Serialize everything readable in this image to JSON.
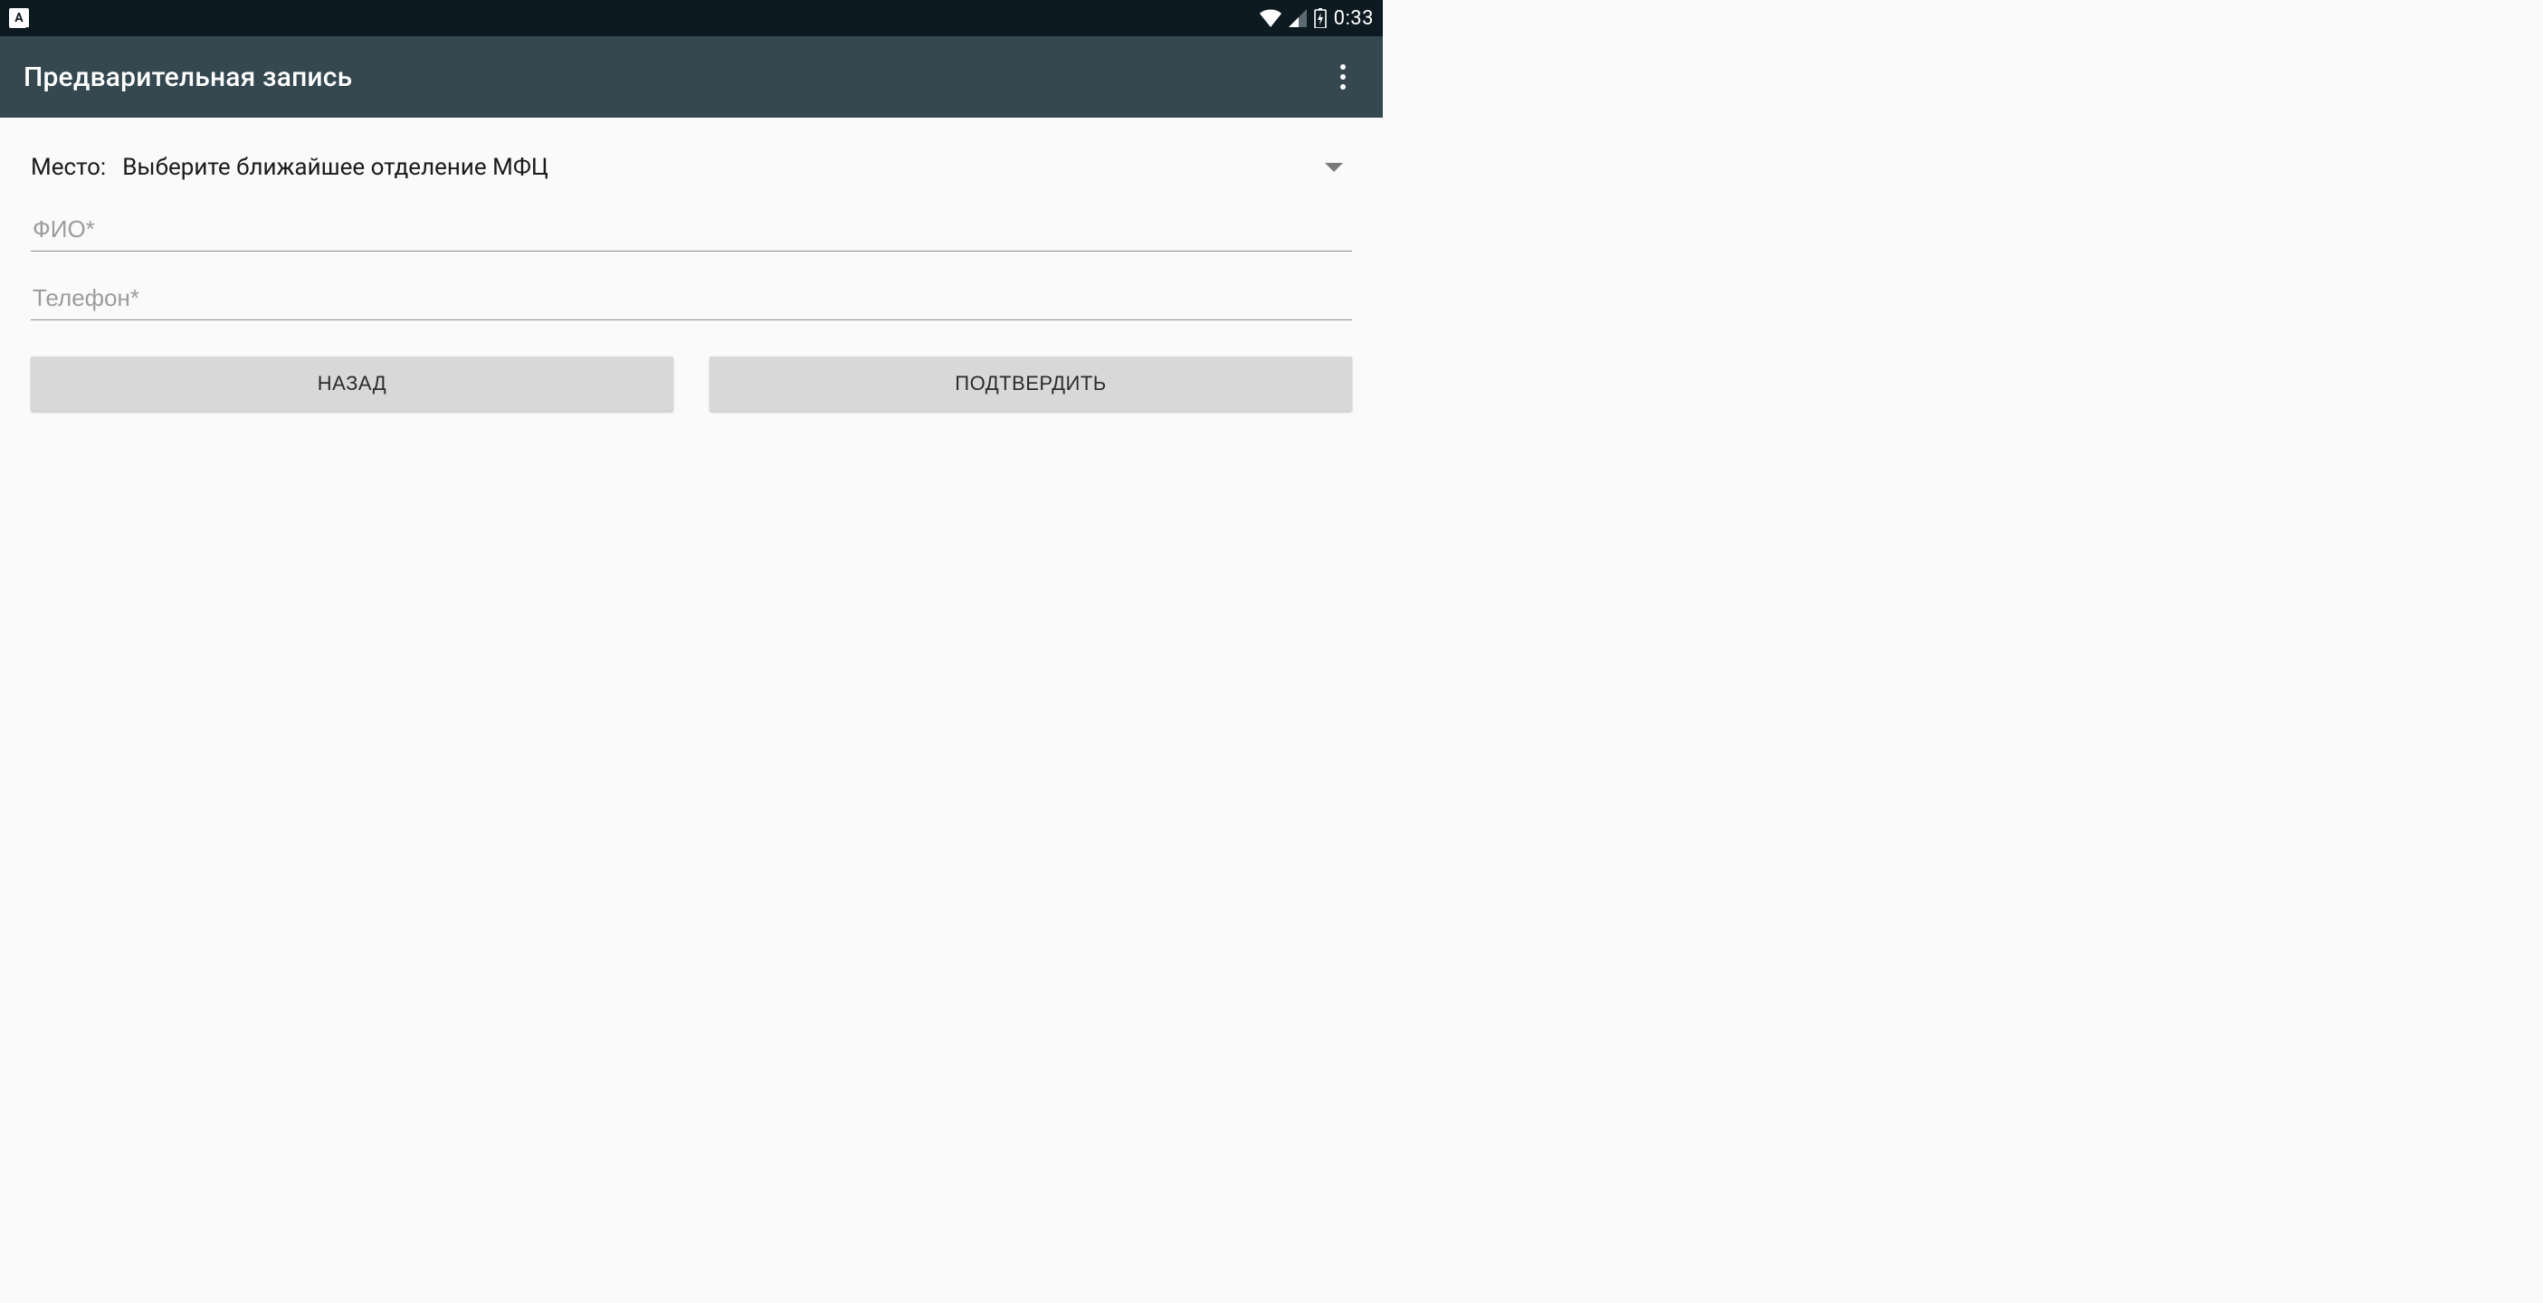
{
  "status_bar": {
    "keyboard_indicator": "A",
    "clock": "0:33"
  },
  "app_bar": {
    "title": "Предварительная запись"
  },
  "form": {
    "place_label": "Место:",
    "place_spinner_text": "Выберите ближайшее отделение МФЦ",
    "name_placeholder": "ФИО*",
    "name_value": "",
    "phone_placeholder": "Телефон*",
    "phone_value": ""
  },
  "buttons": {
    "back": "НАЗАД",
    "confirm": "ПОДТВЕРДИТЬ"
  }
}
